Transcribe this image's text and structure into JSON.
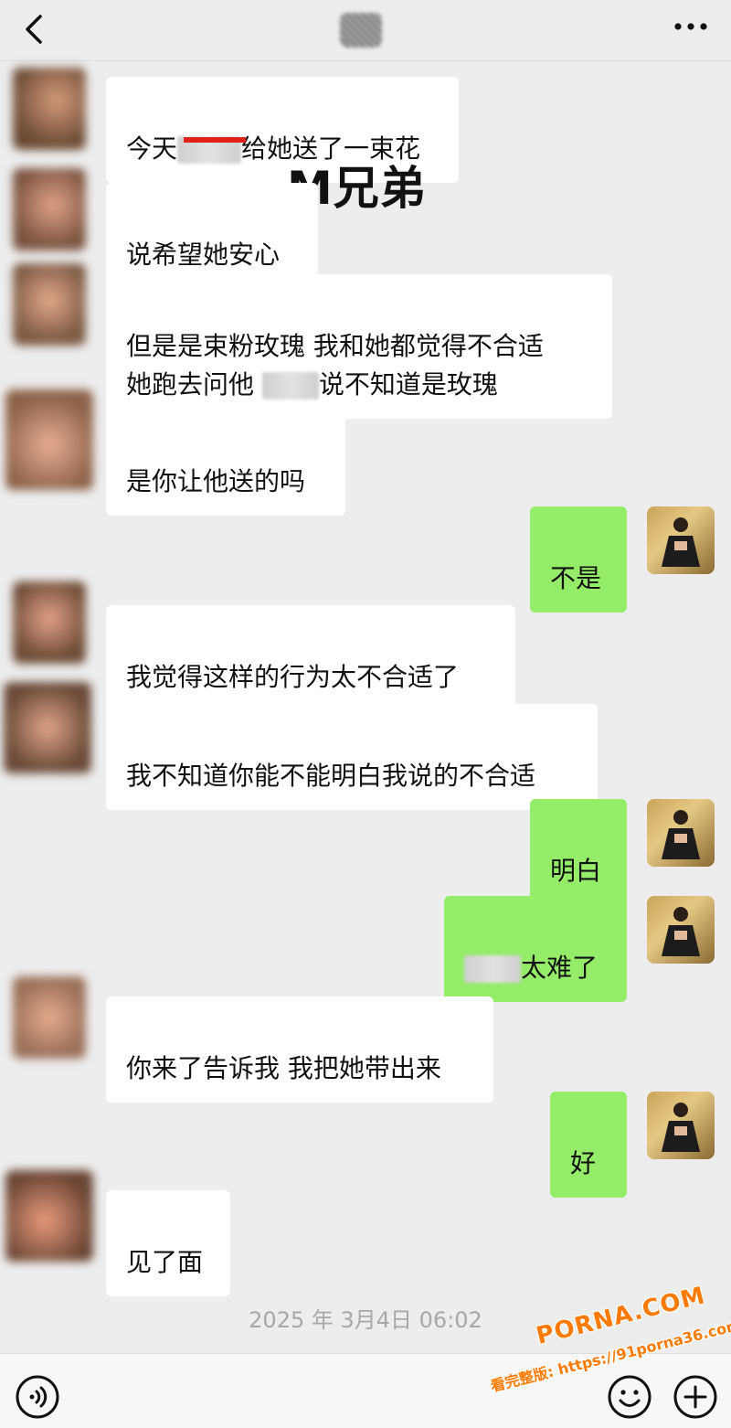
{
  "header": {
    "title": "",
    "icons": {
      "back": "chevron-left-icon",
      "more": "more-dots-icon"
    }
  },
  "overlay_label": "M兄弟",
  "messages": [
    {
      "side": "left",
      "parts": [
        "今天",
        "[mask]",
        "给她送了一束花"
      ]
    },
    {
      "side": "left",
      "parts": [
        "说希望她安心"
      ]
    },
    {
      "side": "left",
      "parts": [
        "但是是束粉玫瑰 我和她都觉得不合适\n她跑去问他 ",
        "[mask]",
        "说不知道是玫瑰"
      ]
    },
    {
      "side": "left",
      "parts": [
        "是你让他送的吗"
      ]
    },
    {
      "side": "right",
      "parts": [
        "不是"
      ]
    },
    {
      "side": "left",
      "parts": [
        "我觉得这样的行为太不合适了"
      ]
    },
    {
      "side": "left",
      "parts": [
        "我不知道你能不能明白我说的不合适"
      ]
    },
    {
      "side": "right",
      "parts": [
        "明白"
      ]
    },
    {
      "side": "right",
      "parts": [
        "[mask]",
        "太难了"
      ]
    },
    {
      "side": "left",
      "parts": [
        "你来了告诉我 我把她带出来"
      ]
    },
    {
      "side": "right",
      "parts": [
        "好"
      ]
    },
    {
      "side": "left",
      "parts": [
        "见了面"
      ]
    }
  ],
  "timestamp": "2025 年 3月4日 06:02",
  "bottom": {
    "icons": {
      "voice": "voice-icon",
      "emoji": "emoji-icon",
      "plus": "plus-icon"
    }
  },
  "watermark": {
    "brand": "PORNA.COM",
    "url": "看完整版: https://91porna36.com"
  },
  "colors": {
    "background": "#ededed",
    "bubble_self": "#95ec69",
    "bubble_other": "#ffffff",
    "highlight_underline": "#e0201a",
    "watermark": "#ff7a00"
  }
}
